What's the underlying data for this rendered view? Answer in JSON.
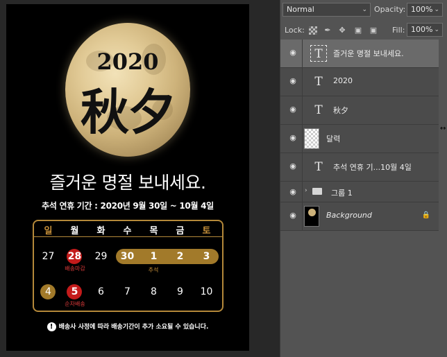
{
  "canvas": {
    "year": "2020",
    "hanja": "秋夕",
    "greeting": "즐거운 명절 보내세요.",
    "holiday_info": "추석 연휴 기간 : 2020년 9월 30일 ~ 10월 4일",
    "weekdays": [
      "일",
      "월",
      "화",
      "수",
      "목",
      "금",
      "토"
    ],
    "week1": [
      "27",
      "28",
      "29",
      "30",
      "1",
      "2",
      "3"
    ],
    "week2": [
      "4",
      "5",
      "6",
      "7",
      "8",
      "9",
      "10"
    ],
    "note_shipping_deadline": "배송마감",
    "note_chuseok": "추석",
    "note_ship_resume": "순차배송",
    "disclaimer": "배송사 사정에 따라 배송기간이 추가 소요될 수 있습니다.",
    "disclaimer_icon": "!"
  },
  "panel": {
    "blend_mode": "Normal",
    "opacity_label": "Opacity:",
    "opacity_value": "100%",
    "lock_label": "Lock:",
    "fill_label": "Fill:",
    "fill_value": "100%",
    "type_glyph": "T",
    "layers": [
      {
        "name": "즐거운 명절 보내세요.",
        "kind": "text",
        "selected": true
      },
      {
        "name": "2020",
        "kind": "text"
      },
      {
        "name": "秋夕",
        "kind": "text"
      },
      {
        "name": "달력",
        "kind": "image"
      },
      {
        "name": "추석 연휴 기...10월 4일",
        "kind": "text"
      },
      {
        "name": "그룹 1",
        "kind": "group"
      },
      {
        "name": "Background",
        "kind": "background"
      }
    ]
  },
  "colors": {
    "accent_gold": "#b5893a",
    "badge_red": "#c41b1b",
    "panel_bg": "#535353"
  }
}
